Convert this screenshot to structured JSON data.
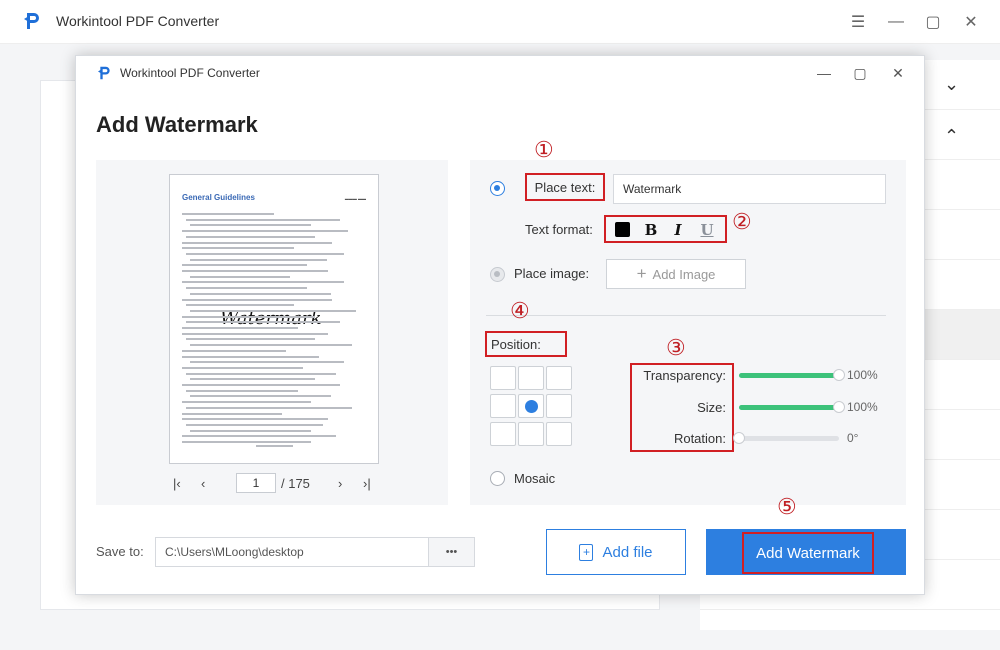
{
  "app": {
    "title": "Workintool PDF Converter"
  },
  "dialog": {
    "title": "Workintool PDF Converter",
    "heading": "Add Watermark",
    "preview": {
      "doc_title": "General Guidelines",
      "doc_watermark": "Watermark",
      "current_page": "1",
      "total_pages": "/ 175"
    },
    "place_text": {
      "label": "Place text:",
      "value": "Watermark",
      "selected": true
    },
    "text_format": {
      "label": "Text format:",
      "bold": "B",
      "italic": "I",
      "underline": "U",
      "color": "#000000"
    },
    "place_image": {
      "label": "Place image:",
      "button": "Add Image"
    },
    "position": {
      "label": "Position:",
      "selected": "center"
    },
    "sliders": [
      {
        "label": "Transparency:",
        "value": "100%",
        "level": 1.0
      },
      {
        "label": "Size:",
        "value": "100%",
        "level": 1.0
      },
      {
        "label": "Rotation:",
        "value": "0°",
        "level": 0.0
      }
    ],
    "mosaic": {
      "label": "Mosaic"
    },
    "save_to": {
      "label": "Save to:",
      "path": "C:\\Users\\MLoong\\desktop",
      "browse": "•••"
    },
    "add_file_button": "Add file",
    "add_watermark_button": "Add Watermark",
    "annotations": [
      "①",
      "②",
      "③",
      "④",
      "⑤"
    ]
  },
  "colors": {
    "accent": "#2d7fe0",
    "annotation_red": "#d11f24",
    "slider_green": "#3cc27a"
  }
}
